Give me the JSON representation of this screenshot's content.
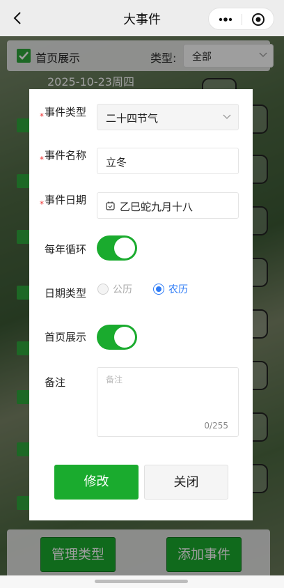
{
  "navbar": {
    "title": "大事件"
  },
  "filter": {
    "checkbox_label": "首页展示",
    "type_label": "类型:",
    "type_value": "全部"
  },
  "background": {
    "peek_date": "2025-10-23周四"
  },
  "bottom": {
    "manage_types": "管理类型",
    "add_event": "添加事件"
  },
  "dialog": {
    "event_type": {
      "label": "事件类型",
      "value": "二十四节气"
    },
    "event_name": {
      "label": "事件名称",
      "value": "立冬"
    },
    "event_date": {
      "label": "事件日期",
      "value": "乙巳蛇九月十八"
    },
    "yearly": {
      "label": "每年循环",
      "on": true
    },
    "date_type": {
      "label": "日期类型",
      "options": [
        "公历",
        "农历"
      ],
      "selected": "农历"
    },
    "home_show": {
      "label": "首页展示",
      "on": true
    },
    "note": {
      "label": "备注",
      "placeholder": "备注",
      "counter": "0/255"
    },
    "buttons": {
      "modify": "修改",
      "close": "关闭"
    }
  },
  "colors": {
    "green": "#1aab2e",
    "radio_active": "#2f7cf6",
    "required": "#ee3333"
  }
}
